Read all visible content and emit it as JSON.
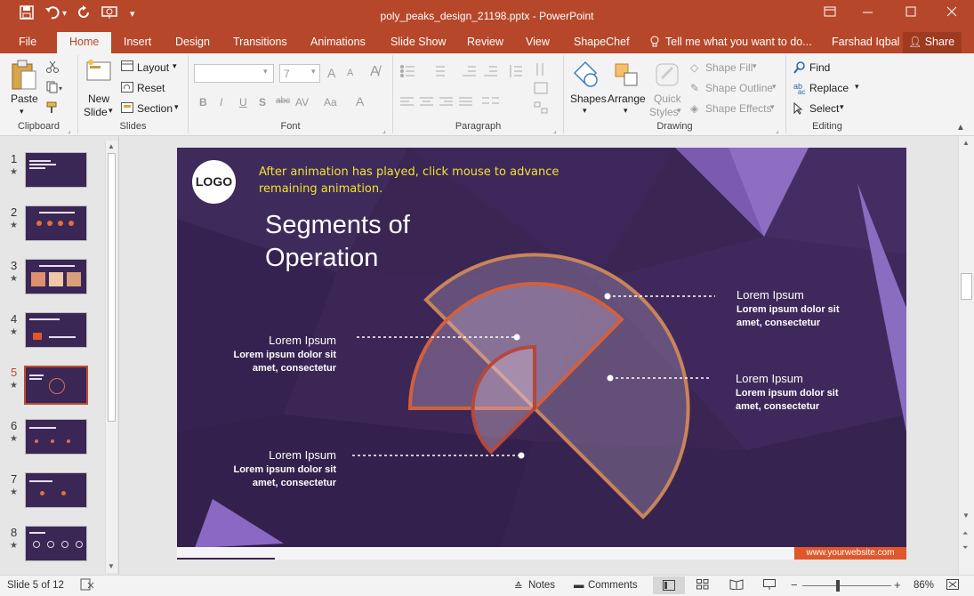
{
  "window": {
    "title": "poly_peaks_design_21198.pptx - PowerPoint",
    "controls": [
      "restore-ribbon-icon",
      "minimize-icon",
      "maximize-icon",
      "close-icon"
    ]
  },
  "quick_access": [
    "save-icon",
    "undo-icon",
    "redo-icon",
    "presenter-icon",
    "customize-icon"
  ],
  "tabs": [
    {
      "label": "File"
    },
    {
      "label": "Home",
      "active": true
    },
    {
      "label": "Insert"
    },
    {
      "label": "Design"
    },
    {
      "label": "Transitions"
    },
    {
      "label": "Animations"
    },
    {
      "label": "Slide Show"
    },
    {
      "label": "Review"
    },
    {
      "label": "View"
    },
    {
      "label": "ShapeChef"
    }
  ],
  "tell_me": "Tell me what you want to do...",
  "user": "Farshad Iqbal",
  "share": "Share",
  "ribbon": {
    "clipboard": {
      "label": "Clipboard",
      "paste": "Paste"
    },
    "slides": {
      "label": "Slides",
      "new_slide": "New",
      "new_slide2": "Slide",
      "layout": "Layout",
      "reset": "Reset",
      "section": "Section"
    },
    "font": {
      "label": "Font",
      "font_name": "",
      "font_size": "7",
      "bold": "B",
      "italic": "I",
      "underline": "U",
      "shadow": "S",
      "strike": "abc",
      "spacing": "AV",
      "case": "Aa",
      "color": "A",
      "grow": "A",
      "shrink": "A"
    },
    "paragraph": {
      "label": "Paragraph"
    },
    "drawing": {
      "label": "Drawing",
      "shapes": "Shapes",
      "arrange": "Arrange",
      "quick_styles": "Quick",
      "quick_styles2": "Styles",
      "shape_fill": "Shape Fill",
      "shape_outline": "Shape Outline",
      "shape_effects": "Shape Effects"
    },
    "editing": {
      "label": "Editing",
      "find": "Find",
      "replace": "Replace",
      "select": "Select"
    }
  },
  "thumbnails": [
    {
      "num": "1",
      "selected": false
    },
    {
      "num": "2",
      "selected": false
    },
    {
      "num": "3",
      "selected": false
    },
    {
      "num": "4",
      "selected": false
    },
    {
      "num": "5",
      "selected": true
    },
    {
      "num": "6",
      "selected": false
    },
    {
      "num": "7",
      "selected": false
    },
    {
      "num": "8",
      "selected": false
    }
  ],
  "slide": {
    "logo": "LOGO",
    "note_line1": "After animation has played, click mouse to advance",
    "note_line2": "remaining animation.",
    "title_line1": "Segments of",
    "title_line2": "Operation",
    "callouts": [
      {
        "heading": "Lorem Ipsum",
        "line1": "Lorem ipsum dolor sit",
        "line2": "amet, consectetur"
      },
      {
        "heading": "Lorem Ipsum",
        "line1": "Lorem ipsum dolor sit",
        "line2": "amet, consectetur"
      },
      {
        "heading": "Lorem Ipsum",
        "line1": "Lorem ipsum dolor sit",
        "line2": "amet, consectetur"
      },
      {
        "heading": "Lorem Ipsum",
        "line1": "Lorem ipsum dolor sit",
        "line2": "amet, consectetur"
      }
    ],
    "website": "www.yourwebsite.com",
    "colors": {
      "background": "#3a2553",
      "accent": "#e0572a",
      "note": "#f2e230",
      "ring_outer": "#c8845a",
      "ring_mid": "#d2603e",
      "ring_inner": "#b4483c"
    }
  },
  "status": {
    "slide_info": "Slide 5 of 12",
    "notes": "Notes",
    "comments": "Comments",
    "zoom": "86%"
  }
}
